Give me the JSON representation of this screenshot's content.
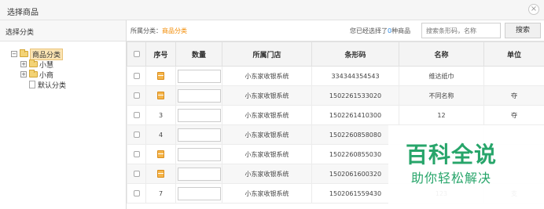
{
  "window": {
    "title": "选择商品",
    "close_glyph": "×"
  },
  "left_panel": {
    "header": "选择分类",
    "tree": [
      {
        "label": "商品分类",
        "toggle": "−",
        "icon": "folder-icon",
        "selected": true
      },
      {
        "label": "小慧",
        "toggle": "+",
        "icon": "folder-icon"
      },
      {
        "label": "小商",
        "toggle": "+",
        "icon": "folder-icon"
      },
      {
        "label": "默认分类",
        "icon": "file-icon"
      }
    ]
  },
  "toolbar": {
    "category_label": "所属分类：",
    "category_value": "商品分类",
    "selected_prefix": "您已经选择了",
    "selected_count": "0",
    "selected_suffix": "种商品",
    "search_placeholder": "搜索条形码，名称",
    "search_button": "搜索"
  },
  "table": {
    "headers": [
      "",
      "序号",
      "数量",
      "所属门店",
      "条形码",
      "名称",
      "单位"
    ],
    "rows": [
      {
        "seq": "",
        "seq_icon": "gift-icon",
        "store": "小东家收银系统",
        "barcode": "334344354543",
        "name": "维达纸巾",
        "unit": ""
      },
      {
        "seq": "",
        "seq_icon": "gift-icon",
        "store": "小东家收银系统",
        "barcode": "1502261533020",
        "name": "不同名称",
        "unit": "夺"
      },
      {
        "seq": "3",
        "seq_icon": "",
        "store": "小东家收银系统",
        "barcode": "1502261410300",
        "name": "12",
        "unit": "夺"
      },
      {
        "seq": "4",
        "seq_icon": "",
        "store": "小东家收银系统",
        "barcode": "1502260858080",
        "name": "",
        "unit": ""
      },
      {
        "seq": "",
        "seq_icon": "gift-icon",
        "store": "小东家收银系统",
        "barcode": "1502260855030",
        "name": "",
        "unit": ""
      },
      {
        "seq": "",
        "seq_icon": "gift-icon",
        "store": "小东家收银系统",
        "barcode": "1502061600320",
        "name": "",
        "unit": ""
      },
      {
        "seq": "7",
        "seq_icon": "",
        "store": "小东家收银系统",
        "barcode": "1502061559430",
        "name": "123",
        "unit": "支"
      }
    ]
  },
  "watermark": {
    "title": "百科全说",
    "subtitle": "助你轻松解决"
  }
}
